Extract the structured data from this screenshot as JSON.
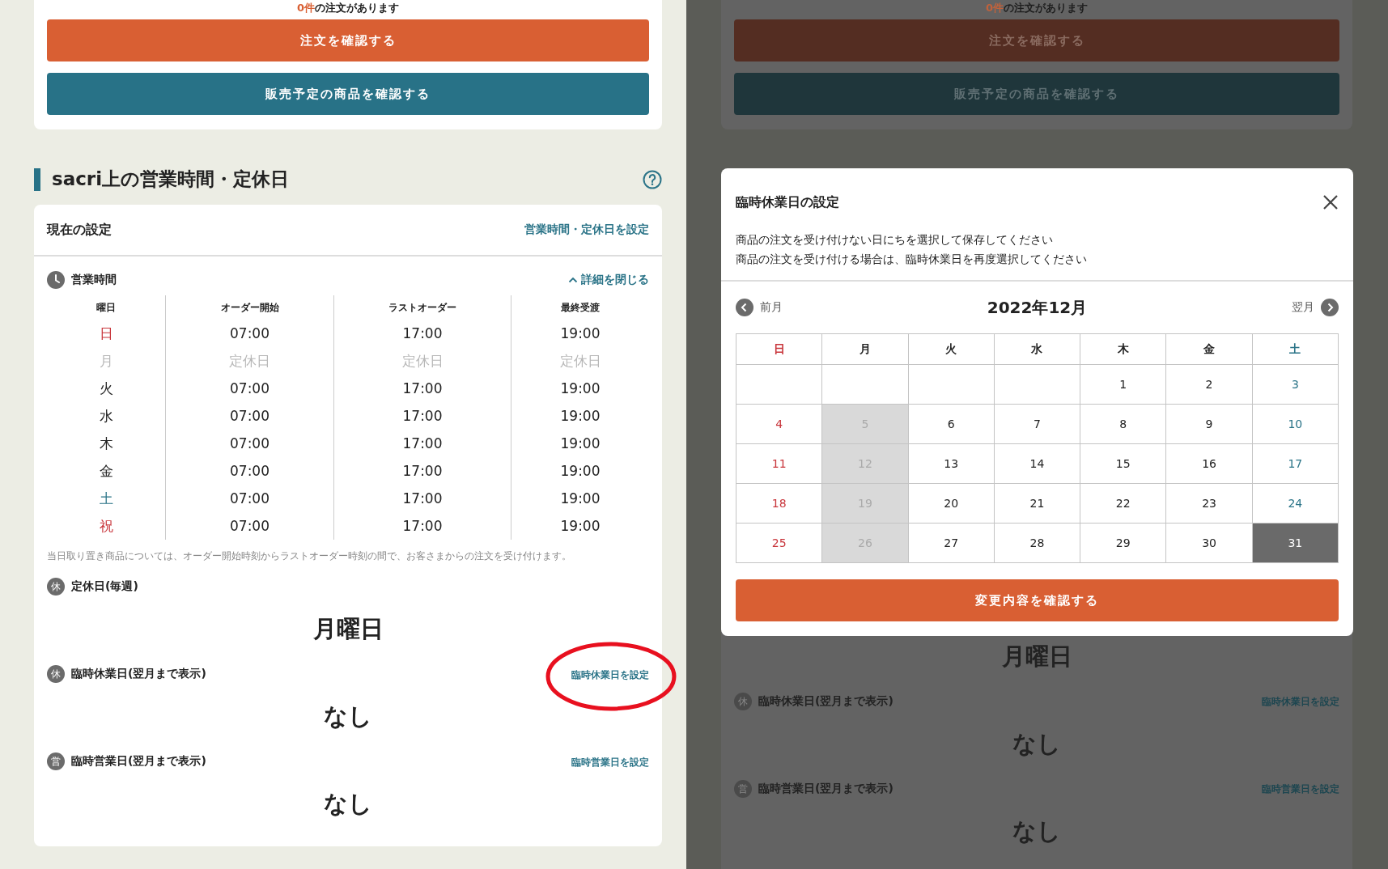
{
  "main_page": {
    "notice": {
      "count": "0件",
      "text": "の注文があります"
    },
    "buttons": [
      {
        "label": "注文を確認する",
        "kind": "primary"
      },
      {
        "label": "販売予定の商品を確認する",
        "kind": "secondary"
      }
    ],
    "section_title": "sacri上の営業時間・定休日",
    "card": {
      "title": "現在の設定",
      "edit_link": "営業時間・定休日を設定",
      "hours": {
        "label": "営業時間",
        "toggle": "詳細を閉じる",
        "expanded": true,
        "columns": [
          "曜日",
          "オーダー開始",
          "ラストオーダー",
          "最終受渡"
        ],
        "rows": [
          {
            "kind": "sunday",
            "cells": [
              "日",
              "07:00",
              "17:00",
              "19:00"
            ]
          },
          {
            "kind": "closed",
            "cells": [
              "月",
              "定休日",
              "定休日",
              "定休日"
            ]
          },
          {
            "kind": "weekday",
            "cells": [
              "火",
              "07:00",
              "17:00",
              "19:00"
            ]
          },
          {
            "kind": "weekday",
            "cells": [
              "水",
              "07:00",
              "17:00",
              "19:00"
            ]
          },
          {
            "kind": "weekday",
            "cells": [
              "木",
              "07:00",
              "17:00",
              "19:00"
            ]
          },
          {
            "kind": "weekday",
            "cells": [
              "金",
              "07:00",
              "17:00",
              "19:00"
            ]
          },
          {
            "kind": "saturday",
            "cells": [
              "土",
              "07:00",
              "17:00",
              "19:00"
            ]
          },
          {
            "kind": "holiday",
            "cells": [
              "祝",
              "07:00",
              "17:00",
              "19:00"
            ]
          }
        ],
        "note": "当日取り置き商品については、オーダー開始時刻からラストオーダー時刻の間で、お客さまからの注文を受け付けます。"
      },
      "blocks": [
        {
          "badge": "休",
          "label": "定休日(毎週)",
          "value": "月曜日"
        },
        {
          "badge": "休",
          "label": "臨時休業日(翌月まで表示)",
          "link": "臨時休業日を設定",
          "value": "なし",
          "highlighted": true
        },
        {
          "badge": "営",
          "label": "臨時営業日(翌月まで表示)",
          "link": "臨時営業日を設定",
          "value": "なし",
          "highlighted": false
        }
      ]
    }
  },
  "dimmed_page": {
    "notice": {
      "count": "0件",
      "text": "の注文があります"
    },
    "buttons": [
      {
        "label": "注文を確認する",
        "kind": "primary"
      },
      {
        "label": "販売予定の商品を確認する",
        "kind": "secondary"
      }
    ],
    "blocks": [
      {
        "value": "月曜日"
      },
      {
        "badge": "休",
        "label": "臨時休業日(翌月まで表示)",
        "link": "臨時休業日を設定",
        "value": "なし"
      },
      {
        "badge": "営",
        "label": "臨時営業日(翌月まで表示)",
        "link": "臨時営業日を設定",
        "value": "なし"
      }
    ]
  },
  "modal": {
    "title": "臨時休業日の設定",
    "lines": [
      "商品の注文を受け付けない日にちを選択して保存してください",
      "商品の注文を受け付ける場合は、臨時休業日を再度選択してください"
    ],
    "prev": "前月",
    "month": "2022年12月",
    "next": "翌月",
    "weekdays": [
      {
        "label": "日",
        "kind": "sunday"
      },
      {
        "label": "月",
        "kind": "weekday"
      },
      {
        "label": "火",
        "kind": "weekday"
      },
      {
        "label": "水",
        "kind": "weekday"
      },
      {
        "label": "木",
        "kind": "weekday"
      },
      {
        "label": "金",
        "kind": "weekday"
      },
      {
        "label": "土",
        "kind": "saturday"
      }
    ],
    "weeks": [
      [
        {
          "disabled": false,
          "selected": false
        },
        {
          "disabled": false,
          "selected": false
        },
        {
          "disabled": false,
          "selected": false
        },
        {
          "disabled": false,
          "selected": false
        },
        {
          "day": "1",
          "disabled": false,
          "selected": false
        },
        {
          "day": "2",
          "disabled": false,
          "selected": false
        },
        {
          "day": "3",
          "disabled": false,
          "selected": false
        }
      ],
      [
        {
          "day": "4",
          "disabled": false,
          "selected": false
        },
        {
          "day": "5",
          "disabled": true,
          "selected": false
        },
        {
          "day": "6",
          "disabled": false,
          "selected": false
        },
        {
          "day": "7",
          "disabled": false,
          "selected": false
        },
        {
          "day": "8",
          "disabled": false,
          "selected": false
        },
        {
          "day": "9",
          "disabled": false,
          "selected": false
        },
        {
          "day": "10",
          "disabled": false,
          "selected": false
        }
      ],
      [
        {
          "day": "11",
          "disabled": false,
          "selected": false
        },
        {
          "day": "12",
          "disabled": true,
          "selected": false
        },
        {
          "day": "13",
          "disabled": false,
          "selected": false
        },
        {
          "day": "14",
          "disabled": false,
          "selected": false
        },
        {
          "day": "15",
          "disabled": false,
          "selected": false
        },
        {
          "day": "16",
          "disabled": false,
          "selected": false
        },
        {
          "day": "17",
          "disabled": false,
          "selected": false
        }
      ],
      [
        {
          "day": "18",
          "disabled": false,
          "selected": false
        },
        {
          "day": "19",
          "disabled": true,
          "selected": false
        },
        {
          "day": "20",
          "disabled": false,
          "selected": false
        },
        {
          "day": "21",
          "disabled": false,
          "selected": false
        },
        {
          "day": "22",
          "disabled": false,
          "selected": false
        },
        {
          "day": "23",
          "disabled": false,
          "selected": false
        },
        {
          "day": "24",
          "disabled": false,
          "selected": false
        }
      ],
      [
        {
          "day": "25",
          "disabled": false,
          "selected": false
        },
        {
          "day": "26",
          "disabled": true,
          "selected": false
        },
        {
          "day": "27",
          "disabled": false,
          "selected": false
        },
        {
          "day": "28",
          "disabled": false,
          "selected": false
        },
        {
          "day": "29",
          "disabled": false,
          "selected": false
        },
        {
          "day": "30",
          "disabled": false,
          "selected": false
        },
        {
          "day": "31",
          "disabled": false,
          "selected": true
        }
      ]
    ],
    "confirm": "変更内容を確認する"
  }
}
